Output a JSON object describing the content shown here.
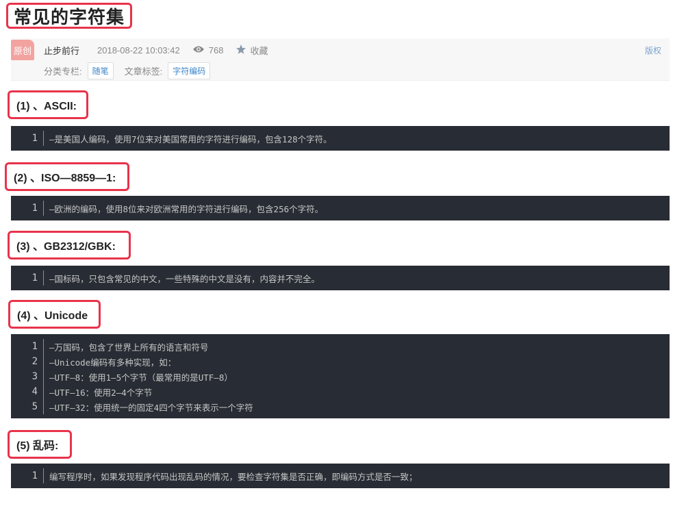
{
  "title": "常见的字符集",
  "meta": {
    "badge": "原创",
    "author": "止步前行",
    "date": "2018-08-22 10:03:42",
    "views": "768",
    "collect": "收藏",
    "copyright": "版权",
    "category_label": "分类专栏:",
    "category_tag": "随笔",
    "tags_label": "文章标签:",
    "tag": "字符编码"
  },
  "sections": [
    {
      "heading": "(1) 、ASCII:",
      "lines": [
        {
          "n": "1",
          "t": "—是美国人编码，使用7位来对美国常用的字符进行编码，包含128个字符。"
        }
      ]
    },
    {
      "heading": "(2) 、ISO—8859—1:",
      "lines": [
        {
          "n": "1",
          "t": "—欧洲的编码，使用8位来对欧洲常用的字符进行编码，包含256个字符。"
        }
      ]
    },
    {
      "heading": "(3) 、GB2312/GBK:",
      "lines": [
        {
          "n": "1",
          "t": "—国标码，只包含常见的中文，一些特殊的中文是没有，内容并不完全。"
        }
      ]
    },
    {
      "heading": "(4) 、Unicode",
      "lines": [
        {
          "n": "1",
          "t": "—万国码，包含了世界上所有的语言和符号"
        },
        {
          "n": "2",
          "t": "—Unicode编码有多种实现，如："
        },
        {
          "n": "3",
          "t": "—UTF—8：使用1—5个字节（最常用的是UTF—8）"
        },
        {
          "n": "4",
          "t": "—UTF—16：使用2—4个字节"
        },
        {
          "n": "5",
          "t": "—UTF—32：使用统一的固定4四个字节来表示一个字符"
        }
      ]
    },
    {
      "heading": "(5) 乱码:",
      "lines": [
        {
          "n": "1",
          "t": "编写程序时，如果发现程序代码出现乱码的情况，要检查字符集是否正确，即编码方式是否一致；"
        }
      ]
    }
  ],
  "icons": {
    "views": "eye-icon",
    "collect": "star-icon"
  },
  "colors": {
    "highlight": "#e8334a",
    "code_bg": "#282c34",
    "badge": "#f2a3a0",
    "tag_text": "#3c86c9"
  }
}
